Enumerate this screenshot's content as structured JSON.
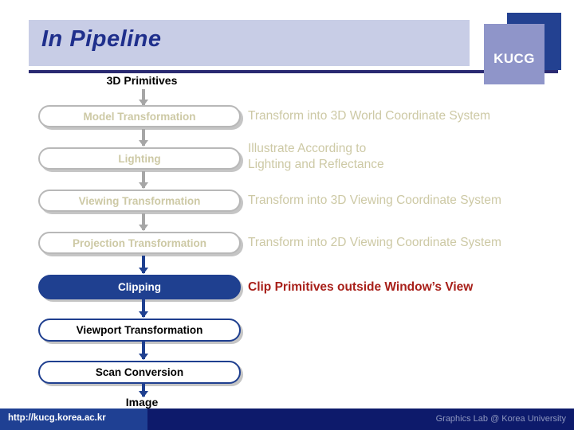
{
  "header": {
    "title": "In Pipeline",
    "logo": {
      "text": "KUCG"
    }
  },
  "flow": {
    "input_label": "3D Primitives",
    "output_label": "Image",
    "stages": [
      {
        "label": "Model Transformation",
        "state": "dim",
        "description": "Transform into 3D World Coordinate System"
      },
      {
        "label": "Lighting",
        "state": "dim",
        "description": "Illustrate According to\nLighting and Reflectance"
      },
      {
        "label": "Viewing Transformation",
        "state": "dim",
        "description": "Transform into 3D Viewing Coordinate System"
      },
      {
        "label": "Projection Transformation",
        "state": "dim",
        "description": "Transform into 2D Viewing Coordinate System"
      },
      {
        "label": "Clipping",
        "state": "active-fill",
        "description": "Clip Primitives outside Window’s View"
      },
      {
        "label": "Viewport Transformation",
        "state": "active-outline",
        "description": ""
      },
      {
        "label": "Scan Conversion",
        "state": "active-outline",
        "description": ""
      }
    ]
  },
  "footer": {
    "url": "http://kucg.korea.ac.kr",
    "lab": "Graphics Lab @ Korea University"
  },
  "colors": {
    "title_band": "#C8CDE6",
    "title_text": "#1F2F8C",
    "rule": "#2A2A72",
    "logo_back": "#234191",
    "logo_front": "#8F95C9",
    "dim_text": "#CDC9A5",
    "active_blue": "#1F4090",
    "highlight_red": "#A8201A",
    "footer_left": "#1F4093",
    "footer_right": "#0D1A6B"
  }
}
